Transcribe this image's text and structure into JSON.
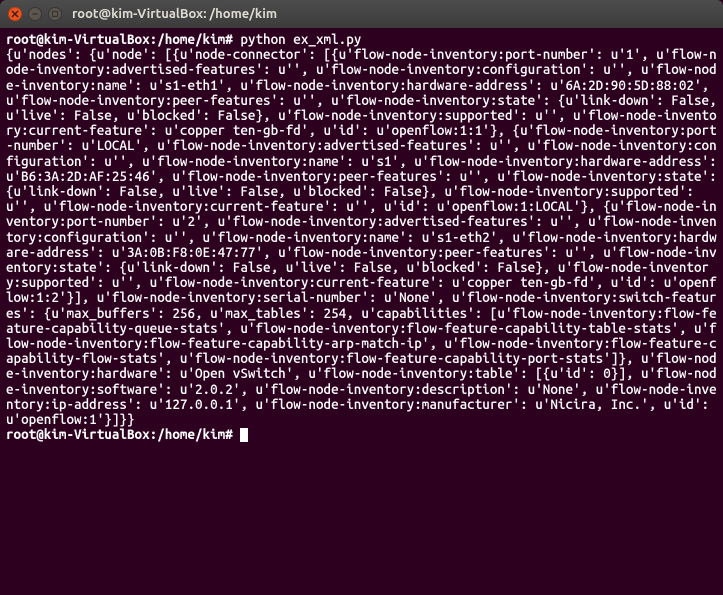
{
  "window": {
    "title": "root@kim-VirtualBox: /home/kim"
  },
  "terminal": {
    "prompt1": "root@kim-VirtualBox:/home/kim#",
    "command1": "python ex_xml.py",
    "output": "{u'nodes': {u'node': [{u'node-connector': [{u'flow-node-inventory:port-number': u'1', u'flow-node-inventory:advertised-features': u'', u'flow-node-inventory:configuration': u'', u'flow-node-inventory:name': u's1-eth1', u'flow-node-inventory:hardware-address': u'6A:2D:90:5D:88:02', u'flow-node-inventory:peer-features': u'', u'flow-node-inventory:state': {u'link-down': False, u'live': False, u'blocked': False}, u'flow-node-inventory:supported': u'', u'flow-node-inventory:current-feature': u'copper ten-gb-fd', u'id': u'openflow:1:1'}, {u'flow-node-inventory:port-number': u'LOCAL', u'flow-node-inventory:advertised-features': u'', u'flow-node-inventory:configuration': u'', u'flow-node-inventory:name': u's1', u'flow-node-inventory:hardware-address': u'B6:3A:2D:AF:25:46', u'flow-node-inventory:peer-features': u'', u'flow-node-inventory:state': {u'link-down': False, u'live': False, u'blocked': False}, u'flow-node-inventory:supported': u'', u'flow-node-inventory:current-feature': u'', u'id': u'openflow:1:LOCAL'}, {u'flow-node-inventory:port-number': u'2', u'flow-node-inventory:advertised-features': u'', u'flow-node-inventory:configuration': u'', u'flow-node-inventory:name': u's1-eth2', u'flow-node-inventory:hardware-address': u'3A:0B:F8:0E:47:77', u'flow-node-inventory:peer-features': u'', u'flow-node-inventory:state': {u'link-down': False, u'live': False, u'blocked': False}, u'flow-node-inventory:supported': u'', u'flow-node-inventory:current-feature': u'copper ten-gb-fd', u'id': u'openflow:1:2'}], u'flow-node-inventory:serial-number': u'None', u'flow-node-inventory:switch-features': {u'max_buffers': 256, u'max_tables': 254, u'capabilities': [u'flow-node-inventory:flow-feature-capability-queue-stats', u'flow-node-inventory:flow-feature-capability-table-stats', u'flow-node-inventory:flow-feature-capability-arp-match-ip', u'flow-node-inventory:flow-feature-capability-flow-stats', u'flow-node-inventory:flow-feature-capability-port-stats']}, u'flow-node-inventory:hardware': u'Open vSwitch', u'flow-node-inventory:table': [{u'id': 0}], u'flow-node-inventory:software': u'2.0.2', u'flow-node-inventory:description': u'None', u'flow-node-inventory:ip-address': u'127.0.0.1', u'flow-node-inventory:manufacturer': u'Nicira, Inc.', u'id': u'openflow:1'}]}}",
    "prompt2": "root@kim-VirtualBox:/home/kim#"
  }
}
